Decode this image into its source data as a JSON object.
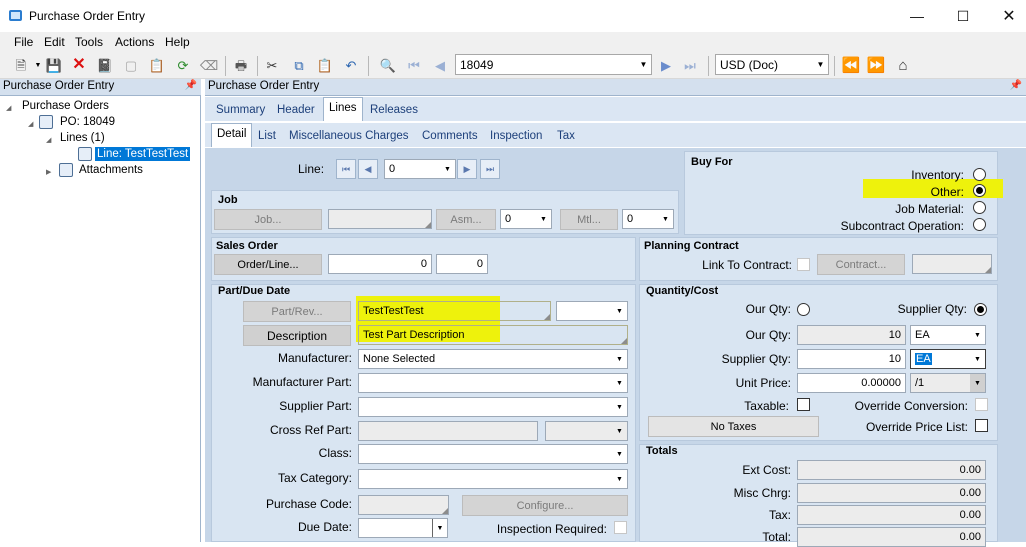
{
  "window": {
    "title": "Purchase Order Entry"
  },
  "menu": [
    "File",
    "Edit",
    "Tools",
    "Actions",
    "Help"
  ],
  "toolbar": {
    "record": "18049",
    "currency": "USD (Doc)"
  },
  "tree": {
    "header": "Purchase Order Entry",
    "root": "Purchase Orders",
    "po": "PO: 18049",
    "lines": "Lines (1)",
    "line": "Line: TestTestTest",
    "attachments": "Attachments"
  },
  "main": {
    "header": "Purchase Order Entry",
    "tabs": [
      "Summary",
      "Header",
      "Lines",
      "Releases"
    ],
    "subtabs": [
      "Detail",
      "List",
      "Miscellaneous Charges",
      "Comments",
      "Inspection",
      "Tax"
    ]
  },
  "line_nav": {
    "label": "Line:",
    "value": "0"
  },
  "job": {
    "title": "Job",
    "job_btn": "Job...",
    "asm_btn": "Asm...",
    "asm_val": "0",
    "mtl_btn": "Mtl...",
    "mtl_val": "0"
  },
  "sales_order": {
    "title": "Sales Order",
    "btn": "Order/Line...",
    "order": "0",
    "line": "0"
  },
  "buy_for": {
    "title": "Buy For",
    "options": [
      {
        "label": "Inventory:",
        "selected": false
      },
      {
        "label": "Other:",
        "selected": true
      },
      {
        "label": "Job Material:",
        "selected": false
      },
      {
        "label": "Subcontract Operation:",
        "selected": false
      }
    ]
  },
  "planning": {
    "title": "Planning Contract",
    "link_label": "Link To Contract:",
    "btn": "Contract..."
  },
  "part": {
    "title": "Part/Due Date",
    "part_btn": "Part/Rev...",
    "part_value": "TestTestTest",
    "desc_btn": "Description",
    "desc_value": "Test Part Description",
    "manufacturer_label": "Manufacturer:",
    "manufacturer_value": "None Selected",
    "mfr_part_label": "Manufacturer Part:",
    "supplier_part_label": "Supplier Part:",
    "cross_ref_label": "Cross Ref Part:",
    "class_label": "Class:",
    "tax_cat_label": "Tax Category:",
    "purchase_code_label": "Purchase Code:",
    "configure_btn": "Configure...",
    "due_date_label": "Due Date:",
    "inspection_label": "Inspection Required:"
  },
  "qty": {
    "title": "Quantity/Cost",
    "our_qty_radio": "Our Qty:",
    "supplier_qty_radio": "Supplier Qty:",
    "our_qty_label": "Our Qty:",
    "our_qty": "10",
    "our_uom": "EA",
    "supplier_qty_label": "Supplier Qty:",
    "supplier_qty": "10",
    "supplier_uom": "EA",
    "unit_price_label": "Unit Price:",
    "unit_price": "0.00000",
    "per": "/1",
    "taxable_label": "Taxable:",
    "override_conv_label": "Override Conversion:",
    "no_taxes_btn": "No Taxes",
    "override_price_label": "Override Price List:"
  },
  "totals": {
    "title": "Totals",
    "ext_cost_label": "Ext Cost:",
    "ext_cost": "0.00",
    "misc_label": "Misc Chrg:",
    "misc": "0.00",
    "tax_label": "Tax:",
    "tax": "0.00",
    "total_label": "Total:",
    "total": "0.00"
  },
  "colors": {
    "highlight": "#eef20c",
    "panel": "#c6d6e8",
    "group": "#d9e5f2",
    "selection": "#0078d7"
  }
}
